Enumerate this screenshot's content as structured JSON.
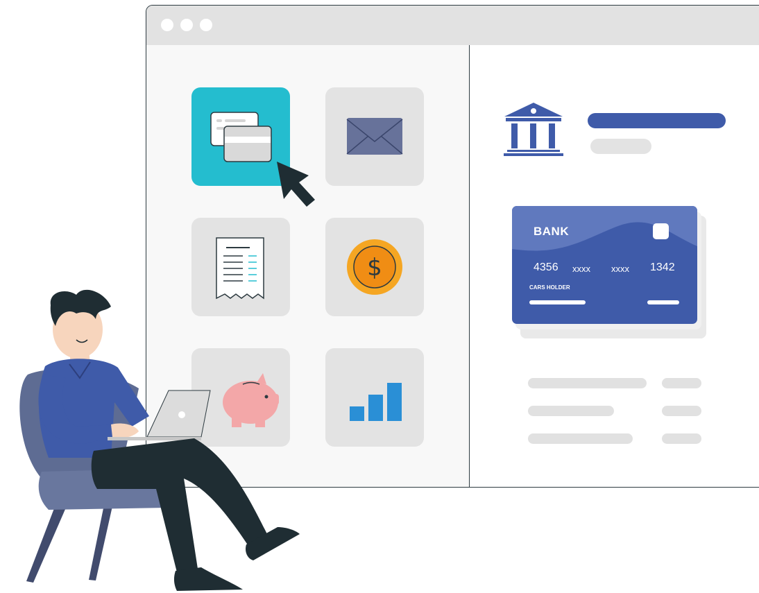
{
  "window": {
    "dots": [
      "dot",
      "dot",
      "dot"
    ]
  },
  "tiles": [
    {
      "name": "payment-tile",
      "icon": "cards-icon",
      "active": true
    },
    {
      "name": "mail-tile",
      "icon": "envelope-icon",
      "active": false
    },
    {
      "name": "receipt-tile",
      "icon": "receipt-icon",
      "active": false
    },
    {
      "name": "dollar-tile",
      "icon": "dollar-coin-icon",
      "active": false
    },
    {
      "name": "savings-tile",
      "icon": "piggy-bank-icon",
      "active": false
    },
    {
      "name": "stats-tile",
      "icon": "bar-chart-icon",
      "active": false
    }
  ],
  "card": {
    "bank_label": "BANK",
    "number_1": "4356",
    "number_2": "xxxx",
    "number_3": "xxxx",
    "number_4": "1342",
    "holder_label": "CARS HOLDER"
  },
  "colors": {
    "accent_teal": "#24bdcf",
    "brand_blue": "#3f5ba9",
    "coin_orange": "#f5a623",
    "chart_blue": "#2a8fd6",
    "piggy_pink": "#f3a7a8",
    "dark": "#1f2d33"
  }
}
